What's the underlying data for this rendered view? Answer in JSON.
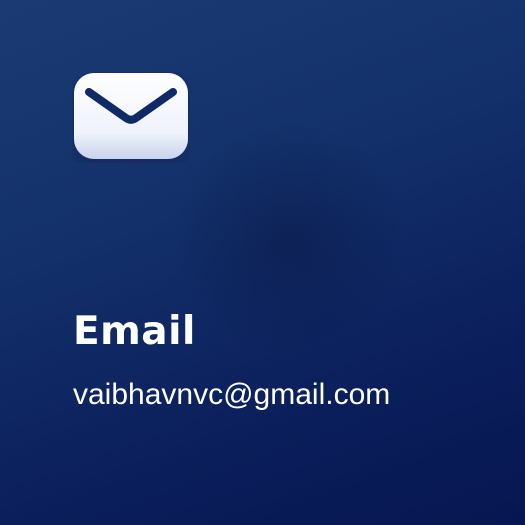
{
  "card": {
    "icon": "envelope-icon",
    "title": "Email",
    "value": "vaibhavnvc@gmail.com"
  },
  "colors": {
    "background_top": "#1b3a73",
    "background_bottom": "#061651",
    "icon_fill": "#eef2fb",
    "icon_stroke": "#102a66",
    "text": "#ffffff"
  }
}
